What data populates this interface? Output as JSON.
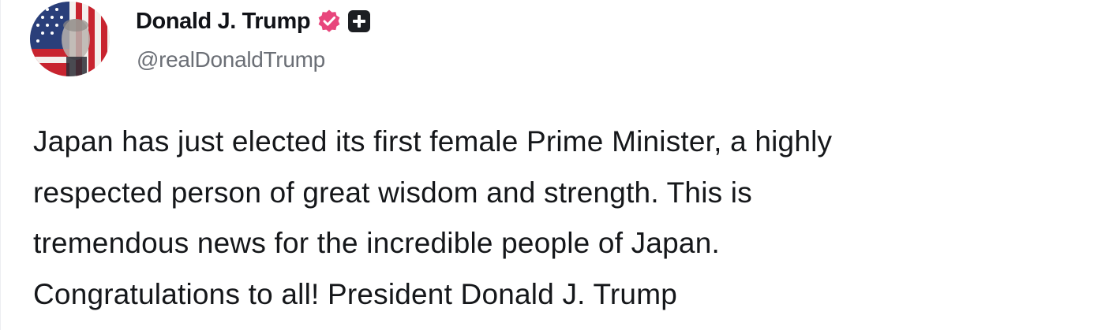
{
  "author": {
    "display_name": "Donald J. Trump",
    "handle": "@realDonaldTrump",
    "avatar_icon": "flag-portrait-avatar",
    "verified_icon": "verified-badge-icon",
    "verified_color": "#e8467c",
    "plus_icon": "plus-square-icon"
  },
  "post": {
    "lines": [
      "Japan has just elected its first female Prime Minister, a highly",
      "respected person of great wisdom and strength. This is",
      "tremendous news for the incredible people of Japan.",
      "Congratulations to all! President Donald J. Trump"
    ]
  }
}
